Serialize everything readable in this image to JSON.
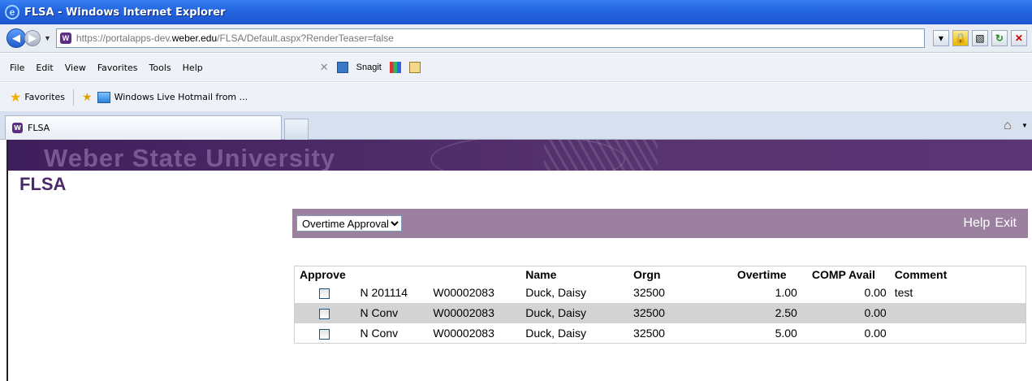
{
  "window": {
    "title": "FLSA - Windows Internet Explorer"
  },
  "address": {
    "url_prefix": "https://portalapps-dev.",
    "url_domain": "weber.edu",
    "url_suffix": "/FLSA/Default.aspx?RenderTeaser=false"
  },
  "menu": {
    "items": [
      "File",
      "Edit",
      "View",
      "Favorites",
      "Tools",
      "Help"
    ],
    "snagit_label": "Snagit"
  },
  "favorites": {
    "label": "Favorites",
    "hotmail": "Windows Live Hotmail from ..."
  },
  "tabs": {
    "active_label": "FLSA"
  },
  "page": {
    "banner_title": "Weber State University",
    "title": "FLSA",
    "select_value": "Overtime Approval",
    "help_label": "Help",
    "exit_label": "Exit"
  },
  "table": {
    "headers": [
      "Approve",
      "",
      "",
      "",
      "Name",
      "Orgn",
      "Overtime",
      "COMP Avail",
      "Comment"
    ],
    "rows": [
      {
        "flag": "N",
        "period": "201114",
        "id": "W00002083",
        "name": "Duck, Daisy",
        "orgn": "32500",
        "overtime": "1.00",
        "comp": "0.00",
        "comment": "test"
      },
      {
        "flag": "N",
        "period": "Conv",
        "id": "W00002083",
        "name": "Duck, Daisy",
        "orgn": "32500",
        "overtime": "2.50",
        "comp": "0.00",
        "comment": ""
      },
      {
        "flag": "N",
        "period": "Conv",
        "id": "W00002083",
        "name": "Duck, Daisy",
        "orgn": "32500",
        "overtime": "5.00",
        "comp": "0.00",
        "comment": ""
      }
    ]
  },
  "colors": {
    "banner": "#57336f",
    "toolbar": "#9b809f",
    "title": "#4b2a6b",
    "alt_row": "#d3d3d3"
  }
}
